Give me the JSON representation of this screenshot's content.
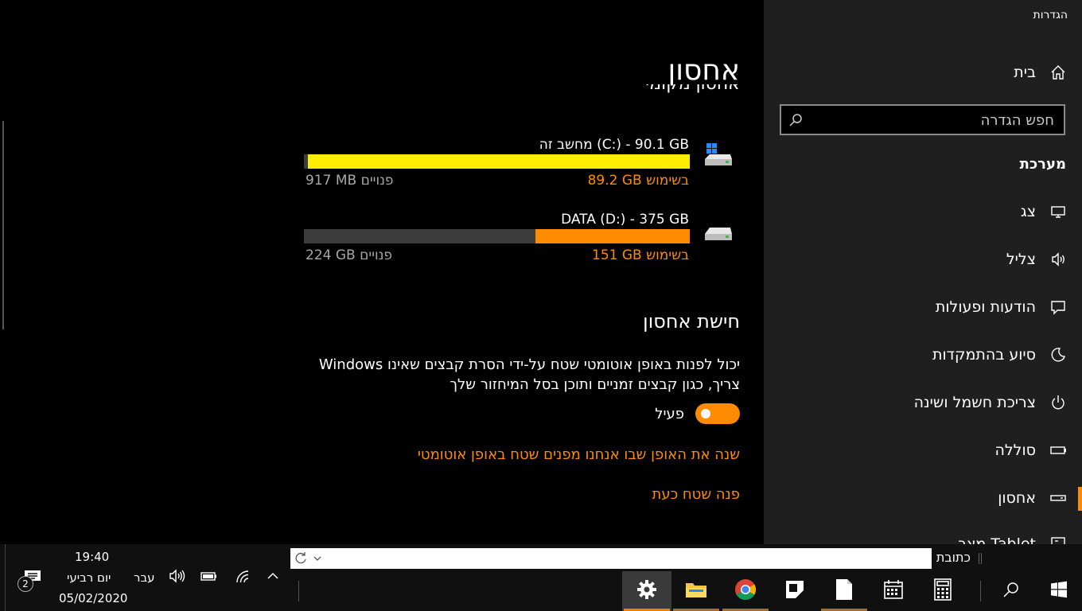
{
  "app_title": "הגדרות",
  "sidebar": {
    "home_label": "בית",
    "search_placeholder": "חפש הגדרה",
    "section_header": "מערכת",
    "items": [
      {
        "label": "צג",
        "icon": "monitor-icon"
      },
      {
        "label": "צליל",
        "icon": "speaker-icon"
      },
      {
        "label": "הודעות ופעולות",
        "icon": "message-icon"
      },
      {
        "label": "סיוע בהתמקדות",
        "icon": "moon-icon"
      },
      {
        "label": "צריכת חשמל ושינה",
        "icon": "power-icon"
      },
      {
        "label": "סוללה",
        "icon": "battery-icon"
      },
      {
        "label": "אחסון",
        "icon": "storage-icon",
        "selected": true
      },
      {
        "label": "מצב Tablet",
        "icon": "tablet-icon"
      }
    ]
  },
  "content": {
    "page_title": "אחסון",
    "clipped_subtitle": "אחסון מקומי",
    "drives": [
      {
        "name": "מחשב זה (C:) - 90.1 GB",
        "used": "89.2 GB בשימוש",
        "free": "917 MB פנויים",
        "used_fraction": 0.99,
        "color": "#ffee00",
        "icon": "windows-drive-icon"
      },
      {
        "name": "DATA (D:) - 375 GB",
        "used": "151 GB בשימוש",
        "free": "224 GB פנויים",
        "used_fraction": 0.4,
        "color": "#ff8c00",
        "icon": "drive-icon"
      }
    ],
    "storage_sense_title": "חישת אחסון",
    "storage_sense_desc": "יכול לפנות באופן אוטומטי שטח על-ידי הסרת קבצים שאינו Windows צריך, כגון קבצים זמניים ותוכן בסל המיחזור שלך",
    "toggle_label": "פעיל",
    "toggle_on": true,
    "link_change": "שנה את האופן שבו אנחנו מפנים שטח באופן אוטומטי",
    "link_free_now": "פנה שטח כעת"
  },
  "taskbar": {
    "address_label": "כתובת",
    "time": "19:40",
    "day": "יום רביעי",
    "date": "05/02/2020",
    "language": "עבר",
    "notification_count": "2",
    "accent": "#ff8c00"
  }
}
